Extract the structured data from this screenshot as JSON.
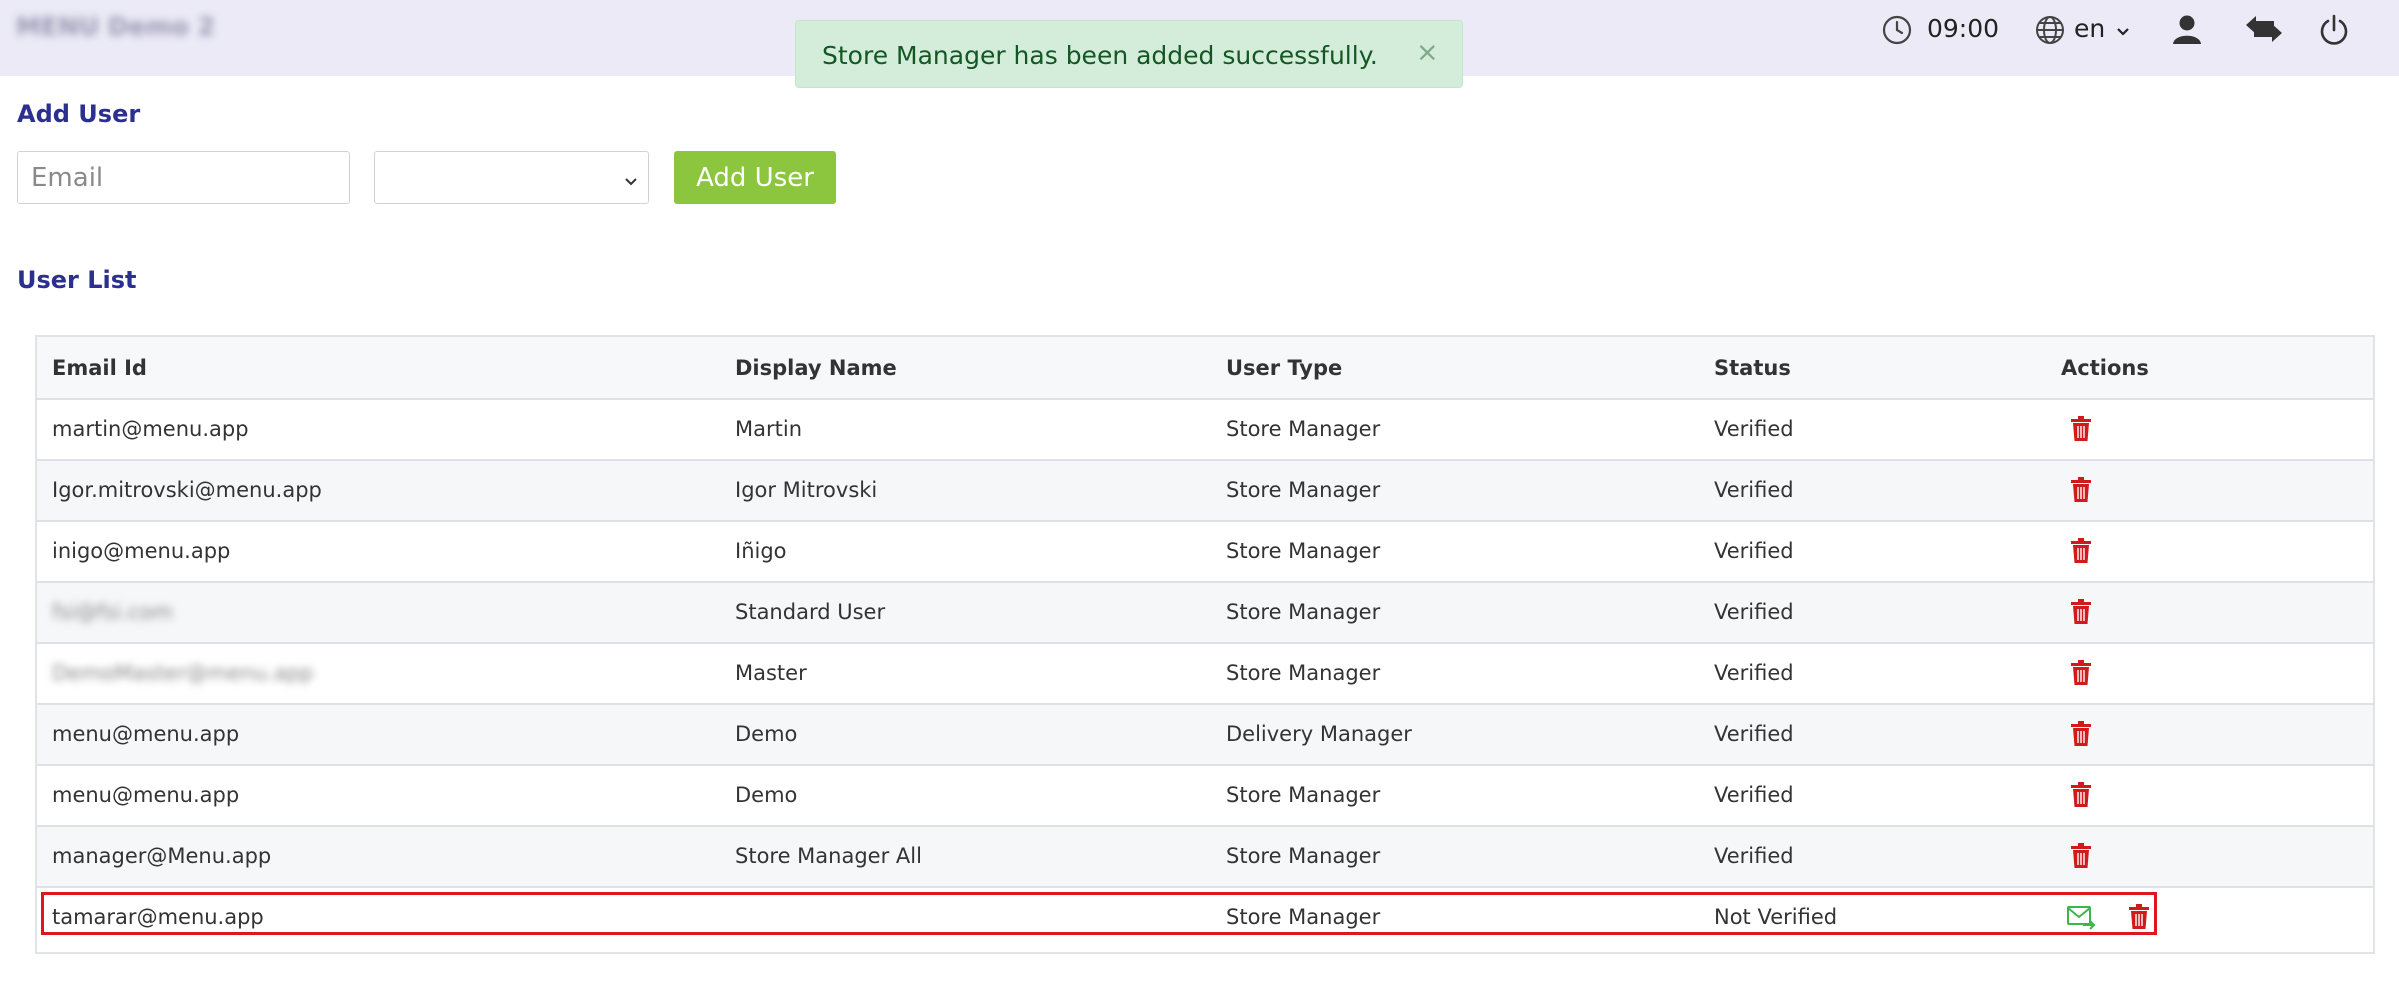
{
  "header": {
    "brand": "MENU Demo 2",
    "time": "09:00",
    "language": "en"
  },
  "toast": {
    "message": "Store Manager has been added successfully.",
    "close": "×"
  },
  "add_user": {
    "title": "Add User",
    "email_placeholder": "Email",
    "email_value": "",
    "role_value": "",
    "button": "Add User"
  },
  "user_list": {
    "title": "User List",
    "columns": [
      "Email Id",
      "Display Name",
      "User Type",
      "Status",
      "Actions"
    ],
    "rows": [
      {
        "email": "martin@menu.app",
        "name": "Martin",
        "type": "Store Manager",
        "status": "Verified"
      },
      {
        "email": "Igor.mitrovski@menu.app",
        "name": "Igor Mitrovski",
        "type": "Store Manager",
        "status": "Verified"
      },
      {
        "email": "inigo@menu.app",
        "name": "Iñigo",
        "type": "Store Manager",
        "status": "Verified"
      },
      {
        "email": "fsi@fsi.com",
        "name": "Standard User",
        "type": "Store Manager",
        "status": "Verified"
      },
      {
        "email": "DemoMaster@menu.app",
        "name": "Master",
        "type": "Store Manager",
        "status": "Verified"
      },
      {
        "email": "menu@menu.app",
        "name": "Demo",
        "type": "Delivery Manager",
        "status": "Verified"
      },
      {
        "email": "menu@menu.app",
        "name": "Demo",
        "type": "Store Manager",
        "status": "Verified"
      },
      {
        "email": "manager@Menu.app",
        "name": "Store Manager All",
        "type": "Store Manager",
        "status": "Verified"
      },
      {
        "email": "tamarar@menu.app",
        "name": "",
        "type": "Store Manager",
        "status": "Not Verified"
      }
    ]
  },
  "colors": {
    "accent": "#2b2f8f",
    "button": "#8cc63f",
    "delete": "#d11a1a",
    "resend": "#3cb54a",
    "highlight": "#e0161f",
    "toast_bg": "#d4edda"
  },
  "icons": [
    "clock-icon",
    "globe-icon",
    "user-icon",
    "switch-icon",
    "power-icon",
    "trash-icon",
    "resend-mail-icon"
  ]
}
